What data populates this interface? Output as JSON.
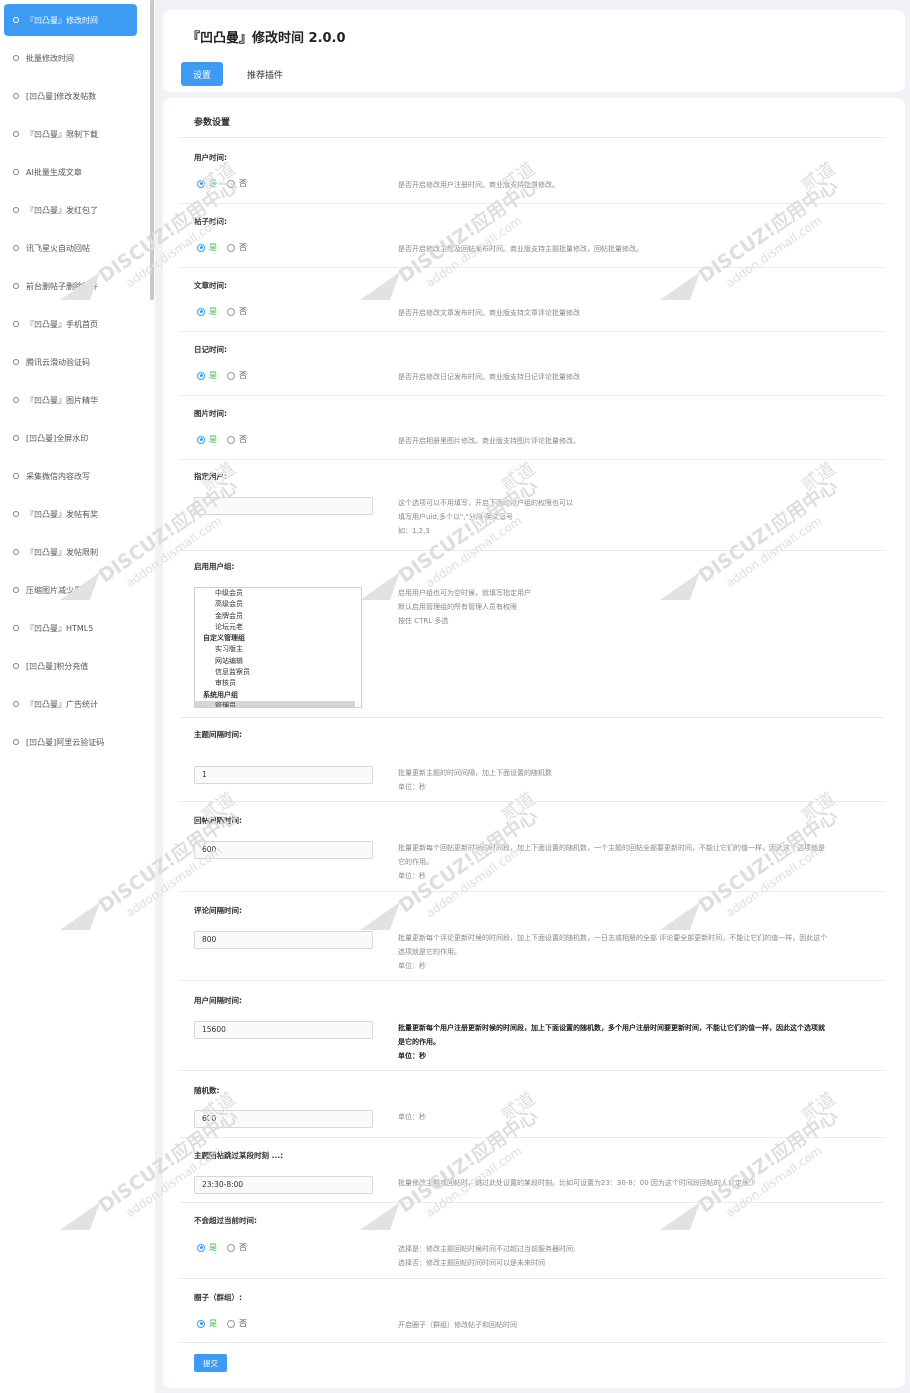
{
  "sidebar": {
    "items": [
      {
        "label": "『凹凸曼』修改时间"
      },
      {
        "label": "批量修改时间"
      },
      {
        "label": "[凹凸曼]修改发帖数"
      },
      {
        "label": "『凹凸曼』限制下载"
      },
      {
        "label": "AI批量生成文章"
      },
      {
        "label": "『凹凸曼』发红包了"
      },
      {
        "label": "讯飞星火自动回帖"
      },
      {
        "label": "前台删帖子删除附件"
      },
      {
        "label": "『凹凸曼』手机首页"
      },
      {
        "label": "腾讯云滑动验证码"
      },
      {
        "label": "『凹凸曼』图片精华"
      },
      {
        "label": "[凹凸曼]全屏水印"
      },
      {
        "label": "采集微信内容改写"
      },
      {
        "label": "『凹凸曼』发帖有奖"
      },
      {
        "label": "『凹凸曼』发帖限制"
      },
      {
        "label": "压缩图片减少费用"
      },
      {
        "label": "『凹凸曼』HTML5"
      },
      {
        "label": "[凹凸曼]积分充值"
      },
      {
        "label": "『凹凸曼』广告统计"
      },
      {
        "label": "[凹凸曼]阿里云验证码"
      }
    ]
  },
  "header": {
    "title": "『凹凸曼』修改时间 2.0.0",
    "tabs": [
      {
        "label": "设置"
      },
      {
        "label": "推荐插件"
      }
    ]
  },
  "main": {
    "section_title": "参数设置",
    "yes": "是",
    "no": "否",
    "fields": {
      "user_time": {
        "label": "用户时间:",
        "value": "是",
        "help": "是否开启修改用户注册时间。商业版支持批量修改。"
      },
      "post_time": {
        "label": "帖子时间:",
        "value": "是",
        "help": "是否开启修改主题及回帖发布时间。商业版支持主题批量修改，回帖批量修改。"
      },
      "article_time": {
        "label": "文章时间:",
        "value": "是",
        "help": "是否开启修改文章发布时间。商业版支持文章评论批量修改"
      },
      "diary_time": {
        "label": "日记时间:",
        "value": "是",
        "help": "是否开启修改日记发布时间。商业版支持日记评论批量修改"
      },
      "image_time": {
        "label": "图片时间:",
        "value": "是",
        "help": "是否开启相册里图片修改。商业版支持图片评论批量修改。"
      },
      "assign_users": {
        "label": "指定用户:",
        "value": "",
        "help1": "这个选项可以不用填写，开启下面的用户组的权限也可以",
        "help2": "填写用户uid,多个以\",\"分隔 英文逗号",
        "help3": "如：1,2,3"
      },
      "enable_groups": {
        "label": "启用用户组:",
        "options": [
          {
            "text": "中级会员",
            "kind": "sub"
          },
          {
            "text": "高级会员",
            "kind": "sub"
          },
          {
            "text": "金牌会员",
            "kind": "sub"
          },
          {
            "text": "论坛元老",
            "kind": "sub"
          },
          {
            "text": "自定义管理组",
            "kind": "grp"
          },
          {
            "text": "实习版主",
            "kind": "sub"
          },
          {
            "text": "网站编辑",
            "kind": "sub"
          },
          {
            "text": "信息监察员",
            "kind": "sub"
          },
          {
            "text": "审核员",
            "kind": "sub"
          },
          {
            "text": "系统用户组",
            "kind": "grp"
          },
          {
            "text": "管理员",
            "kind": "sub sel"
          }
        ],
        "help1": "启用用户组也可为空时候，就填写指定用户",
        "help2": "默认启用管理组的所有管理人员有权限",
        "help3": "按住 CTRL 多选"
      },
      "thread_interval": {
        "label": "主题间隔时间:",
        "value": "1",
        "help1": "批量更新主题的时间间隔，加上下面设置的随机数",
        "help2": "单位：秒"
      },
      "reply_interval": {
        "label": "回帖间隔时间:",
        "value": "600",
        "help1": "批量更新每个回帖更新时候的时间段，加上下面设置的随机数，一个主题的回帖全部要更新时间，不能让它们的值一样，因此这个选项就是",
        "help1b": "它的作用。",
        "help2": "单位：秒"
      },
      "comment_interval": {
        "label": "评论间隔时间:",
        "value": "800",
        "help1": "批量更新每个评论更新时候的时间段，加上下面设置的随机数，一日志或相册的全部 评论要全部更新时间，不能让它们的值一样，因此这个",
        "help1b": "选项就是它的作用。",
        "help2": "单位：秒"
      },
      "user_interval": {
        "label": "用户间隔时间:",
        "value": "15600",
        "help1": "批量更新每个用户注册更新时候的时间段，加上下面设置的随机数，多个用户注册时间要更新时间，不能让它们的值一样，因此这个选项就",
        "help1b": "是它的作用。",
        "help2": "单位：秒"
      },
      "random": {
        "label": "随机数:",
        "value": "600",
        "help": "单位：秒"
      },
      "skip_period": {
        "label": "主题回帖跳过某段时刻 ...:",
        "value": "23:30-8:00",
        "help": "批量修改主题或回帖时，跳过此处设置的某段时刻。比如可设置为23：30-8：00 因为这个时间段回帖的人肯定很少"
      },
      "not_exceed": {
        "label": "不会超过当前时间:",
        "value": "是",
        "help1": "选择是：修改主题回帖时候时间不过超过当前服务器时间;",
        "help2": "选择否：修改主题回帖时间时间可以是未来时间"
      },
      "circle": {
        "label": "圈子（群组）:",
        "value": "是",
        "help": "开启圈子（群组）修改帖子和回帖时间"
      }
    },
    "submit_label": "提交"
  },
  "watermark": {
    "line1": "DISCUZ!应用中心",
    "line2": "addon.dismall.com",
    "brand": "贰道"
  },
  "colors": {
    "accent": "#3e9bf3",
    "yes_green": "#3bb54a"
  }
}
